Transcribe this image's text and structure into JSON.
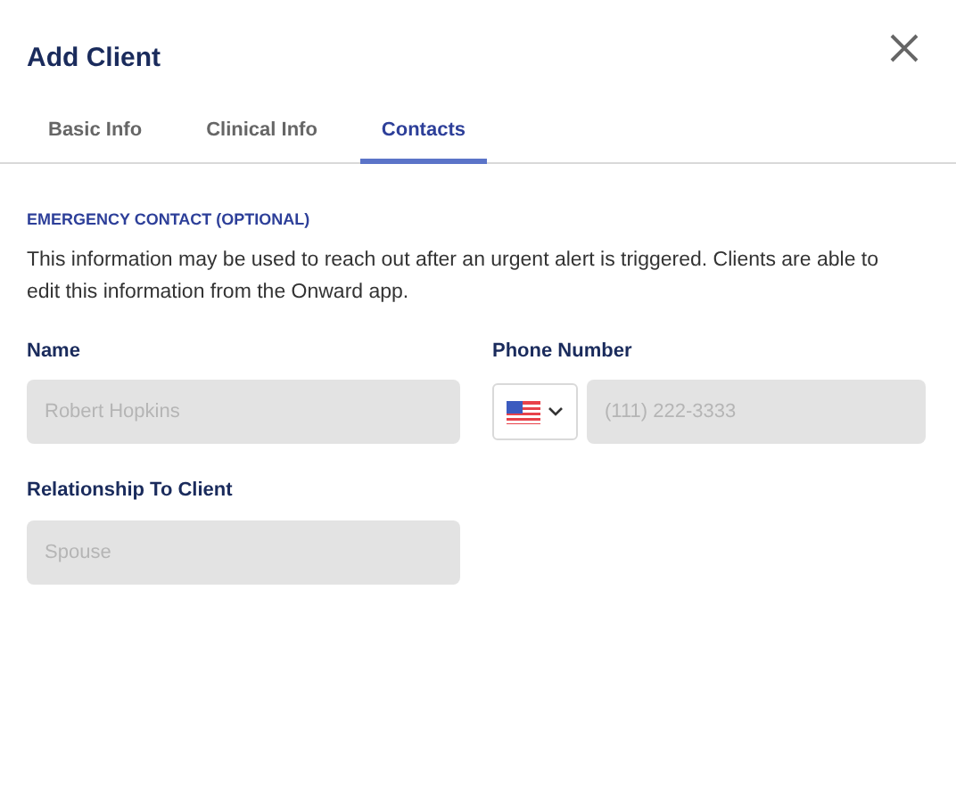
{
  "dialog": {
    "title": "Add Client"
  },
  "tabs": [
    {
      "label": "Basic Info",
      "selected": false
    },
    {
      "label": "Clinical Info",
      "selected": false
    },
    {
      "label": "Contacts",
      "selected": true
    }
  ],
  "section": {
    "heading": "EMERGENCY CONTACT (OPTIONAL)",
    "description": "This information may be used to reach out after an urgent alert is triggered. Clients are able to edit this information from the Onward app."
  },
  "fields": [
    {
      "kind": "text",
      "label": "Name",
      "placeholder": "Robert Hopkins"
    },
    {
      "kind": "phone",
      "label": "Phone Number",
      "placeholder": "(111) 222-3333"
    },
    {
      "kind": "text",
      "label": "Relationship To Client",
      "placeholder": "Spouse"
    }
  ]
}
